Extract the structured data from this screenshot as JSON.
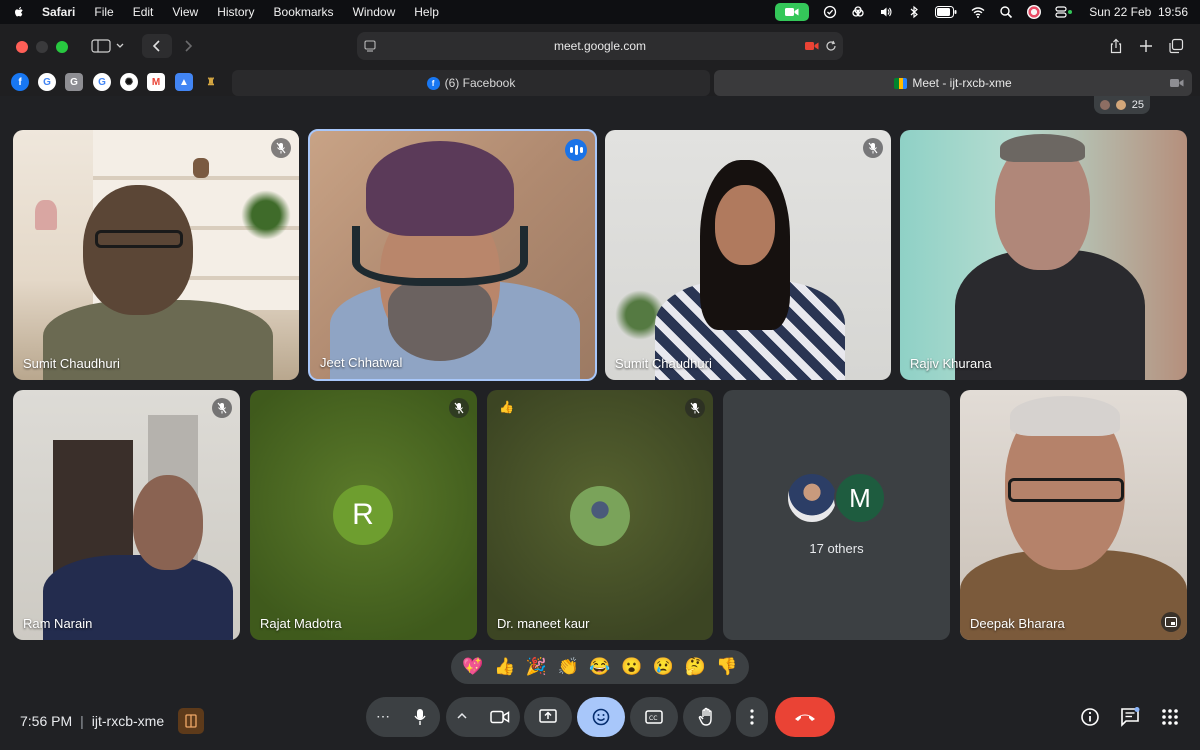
{
  "menubar": {
    "items": [
      "Safari",
      "File",
      "Edit",
      "View",
      "History",
      "Bookmarks",
      "Window",
      "Help"
    ],
    "datetime": "Sun 22 Feb  19:56"
  },
  "browser": {
    "url": "meet.google.com",
    "tabs": [
      {
        "label": "(6) Facebook",
        "active": false
      },
      {
        "label": "Meet - ijt-rxcb-xme",
        "active": true
      }
    ],
    "pinned_icons": [
      "facebook-icon",
      "google-icon",
      "google-icon",
      "google-icon",
      "chatgpt-icon",
      "gmail-icon",
      "drive-icon",
      "extension-icon"
    ]
  },
  "meet": {
    "participant_count": "25",
    "tiles": [
      {
        "name": "Sumit Chaudhuri",
        "muted": true
      },
      {
        "name": "Jeet Chhatwal",
        "speaking": true
      },
      {
        "name": "Sumit Chaudhuri",
        "muted": true
      },
      {
        "name": "Rajiv Khurana",
        "muted": false
      },
      {
        "name": "Ram Narain",
        "muted": true
      },
      {
        "name": "Rajat Madotra",
        "muted": true,
        "avatar_letter": "R",
        "bg": "#4d6b1f"
      },
      {
        "name": "Dr. maneet kaur",
        "muted": true,
        "reaction": "👍"
      },
      {
        "name": "Deepak Bharara",
        "muted": false
      }
    ],
    "others": {
      "label": "17 others",
      "avatar_letter": "M"
    },
    "reactions": [
      "💖",
      "👍",
      "🎉",
      "👏",
      "😂",
      "😮",
      "😢",
      "🤔",
      "👎"
    ],
    "bottom": {
      "time": "7:56 PM",
      "separator": "|",
      "meeting_code": "ijt-rxcb-xme"
    }
  },
  "colors": {
    "accent": "#a8c7fa",
    "end_call": "#ea4335",
    "camera_pill": "#34c759",
    "background": "#202124"
  }
}
